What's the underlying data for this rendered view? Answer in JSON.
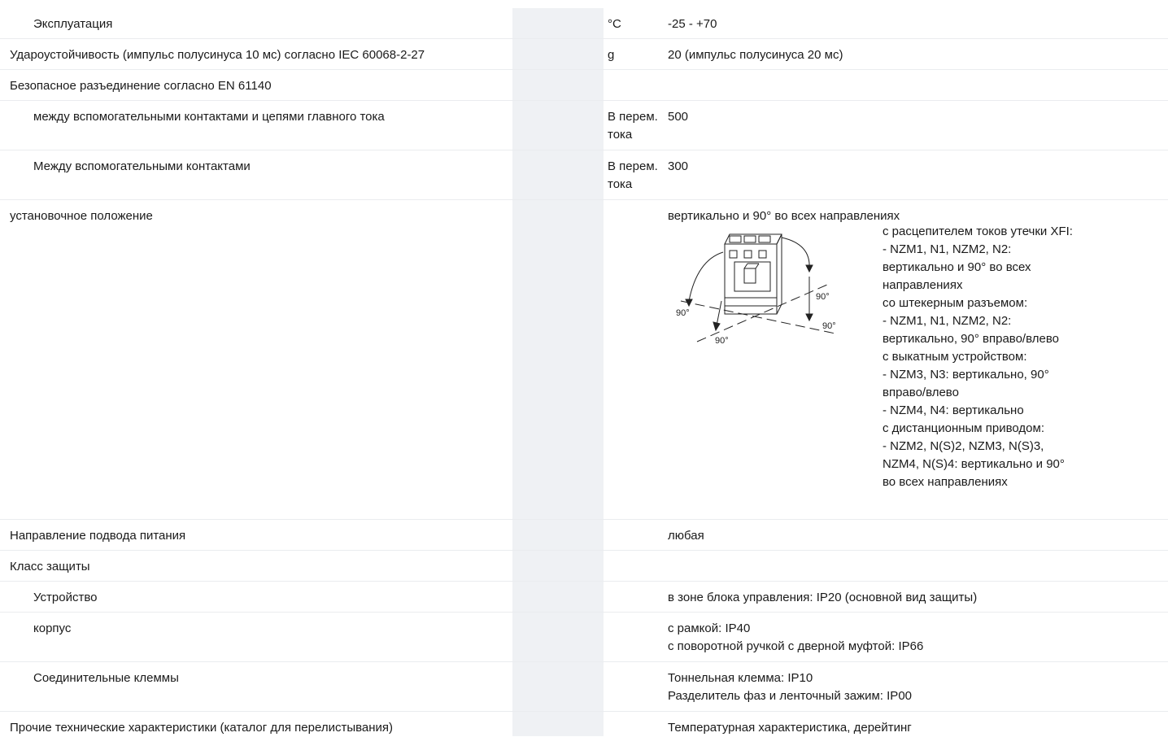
{
  "rows": [
    {
      "name": "Эксплуатация",
      "unit": "°C",
      "value": "-25 - +70"
    },
    {
      "name": "Удароустойчивость (импульс полусинуса 10 мс) согласно IEC 60068-2-27",
      "unit": "g",
      "value": "20 (импульс полусинуса 20 мс)"
    },
    {
      "name": "Безопасное разъединение согласно EN 61140",
      "unit": "",
      "value": ""
    },
    {
      "name": "между вспомогательными контактами и цепями главного тока",
      "unit_line1": "В перем.",
      "unit_line2": "тока",
      "value": "500"
    },
    {
      "name": "Между вспомогательными контактами",
      "unit_line1": "В перем.",
      "unit_line2": "тока",
      "value": "300"
    },
    {
      "name": "установочное положение",
      "unit": "",
      "value": "вертикально и 90° во всех направлениях"
    },
    {
      "name": "Направление подвода питания",
      "unit": "",
      "value": "любая"
    },
    {
      "name": "Класс защиты",
      "unit": "",
      "value": ""
    },
    {
      "name": "Устройство",
      "unit": "",
      "value": "в зоне блока управления: IP20 (основной вид защиты)"
    },
    {
      "name": "корпус",
      "unit": "",
      "value_line1": "с рамкой: IP40",
      "value_line2": "с поворотной ручкой с дверной муфтой: IP66"
    },
    {
      "name": "Соединительные клеммы",
      "unit": "",
      "value_line1": "Тоннельная клемма: IP10",
      "value_line2": "Разделитель фаз и ленточный зажим: IP00"
    },
    {
      "name": "Прочие технические характеристики (каталог для перелистывания)",
      "unit": "",
      "value": "Температурная характеристика, дерейтинг"
    }
  ],
  "mounting_notes": [
    "с расцепителем токов утечки XFI:",
    "- NZM1, N1, NZM2, N2:",
    "вертикально и 90° во всех",
    "направлениях",
    "со штекерным разъемом:",
    "- NZM1, N1, NZM2, N2:",
    "вертикально, 90° вправо/влево",
    "с выкатным устройством:",
    "- NZM3, N3: вертикально, 90°",
    "вправо/влево",
    "- NZM4, N4: вертикально",
    "с дистанционным приводом:",
    "- NZM2, N(S)2, NZM3, N(S)3,",
    "NZM4, N(S)4: вертикально и 90°",
    "во всех направлениях"
  ],
  "diagram": {
    "angle_label": "90°",
    "icon": "circuit-breaker-mounting-diagram"
  }
}
